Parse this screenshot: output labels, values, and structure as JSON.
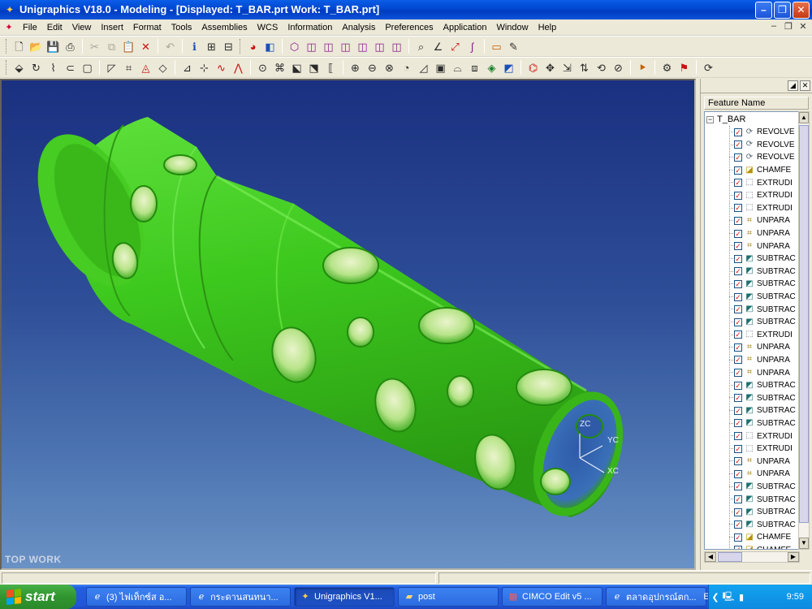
{
  "window": {
    "title": "Unigraphics V18.0 - Modeling - [Displayed: T_BAR.prt   Work: T_BAR.prt]",
    "app_icon": "unigraphics-logo-icon"
  },
  "menu": {
    "items": [
      "File",
      "Edit",
      "View",
      "Insert",
      "Format",
      "Tools",
      "Assemblies",
      "WCS",
      "Information",
      "Analysis",
      "Preferences",
      "Application",
      "Window",
      "Help"
    ]
  },
  "viewport": {
    "view_label": "TOP WORK",
    "axes": {
      "z": "ZC",
      "y": "YC",
      "x": "XC"
    },
    "model_color": "#3dc81e",
    "background_top": "#1a3080",
    "background_bottom": "#6a92c4"
  },
  "navigator": {
    "header": "Feature Name",
    "root": "T_BAR",
    "features": [
      {
        "type": "revolve",
        "label": "REVOLVE"
      },
      {
        "type": "revolve",
        "label": "REVOLVE"
      },
      {
        "type": "revolve",
        "label": "REVOLVE"
      },
      {
        "type": "chamfer",
        "label": "CHAMFE"
      },
      {
        "type": "extrude",
        "label": "EXTRUDI"
      },
      {
        "type": "extrude",
        "label": "EXTRUDI"
      },
      {
        "type": "extrude",
        "label": "EXTRUDI"
      },
      {
        "type": "unpara",
        "label": "UNPARA"
      },
      {
        "type": "unpara",
        "label": "UNPARA"
      },
      {
        "type": "unpara",
        "label": "UNPARA"
      },
      {
        "type": "subtract",
        "label": "SUBTRAC"
      },
      {
        "type": "subtract",
        "label": "SUBTRAC"
      },
      {
        "type": "subtract",
        "label": "SUBTRAC"
      },
      {
        "type": "subtract",
        "label": "SUBTRAC"
      },
      {
        "type": "subtract",
        "label": "SUBTRAC"
      },
      {
        "type": "subtract",
        "label": "SUBTRAC"
      },
      {
        "type": "extrude",
        "label": "EXTRUDI"
      },
      {
        "type": "unpara",
        "label": "UNPARA"
      },
      {
        "type": "unpara",
        "label": "UNPARA"
      },
      {
        "type": "unpara",
        "label": "UNPARA"
      },
      {
        "type": "subtract",
        "label": "SUBTRAC"
      },
      {
        "type": "subtract",
        "label": "SUBTRAC"
      },
      {
        "type": "subtract",
        "label": "SUBTRAC"
      },
      {
        "type": "subtract",
        "label": "SUBTRAC"
      },
      {
        "type": "extrude",
        "label": "EXTRUDI"
      },
      {
        "type": "extrude",
        "label": "EXTRUDI"
      },
      {
        "type": "unpara",
        "label": "UNPARA"
      },
      {
        "type": "unpara",
        "label": "UNPARA"
      },
      {
        "type": "subtract",
        "label": "SUBTRAC"
      },
      {
        "type": "subtract",
        "label": "SUBTRAC"
      },
      {
        "type": "subtract",
        "label": "SUBTRAC"
      },
      {
        "type": "subtract",
        "label": "SUBTRAC"
      },
      {
        "type": "chamfer",
        "label": "CHAMFE"
      },
      {
        "type": "chamfer",
        "label": "CHAMFE"
      }
    ]
  },
  "taskbar": {
    "start_label": "start",
    "tasks": [
      {
        "label": "(3) ไฟเท็กซ์ส อ...",
        "icon": "ie-icon",
        "active": false
      },
      {
        "label": "กระดานสนทนา...",
        "icon": "ie-icon",
        "active": false
      },
      {
        "label": "Unigraphics V1...",
        "icon": "unigraphics-icon",
        "active": true
      },
      {
        "label": "post",
        "icon": "folder-icon",
        "active": false
      },
      {
        "label": "CIMCO Edit v5 ...",
        "icon": "cimco-icon",
        "active": false
      },
      {
        "label": "ตลาดอุปกรณ์ตก...",
        "icon": "ie-icon",
        "active": false
      }
    ],
    "language": "EN",
    "clock": "9:59"
  }
}
